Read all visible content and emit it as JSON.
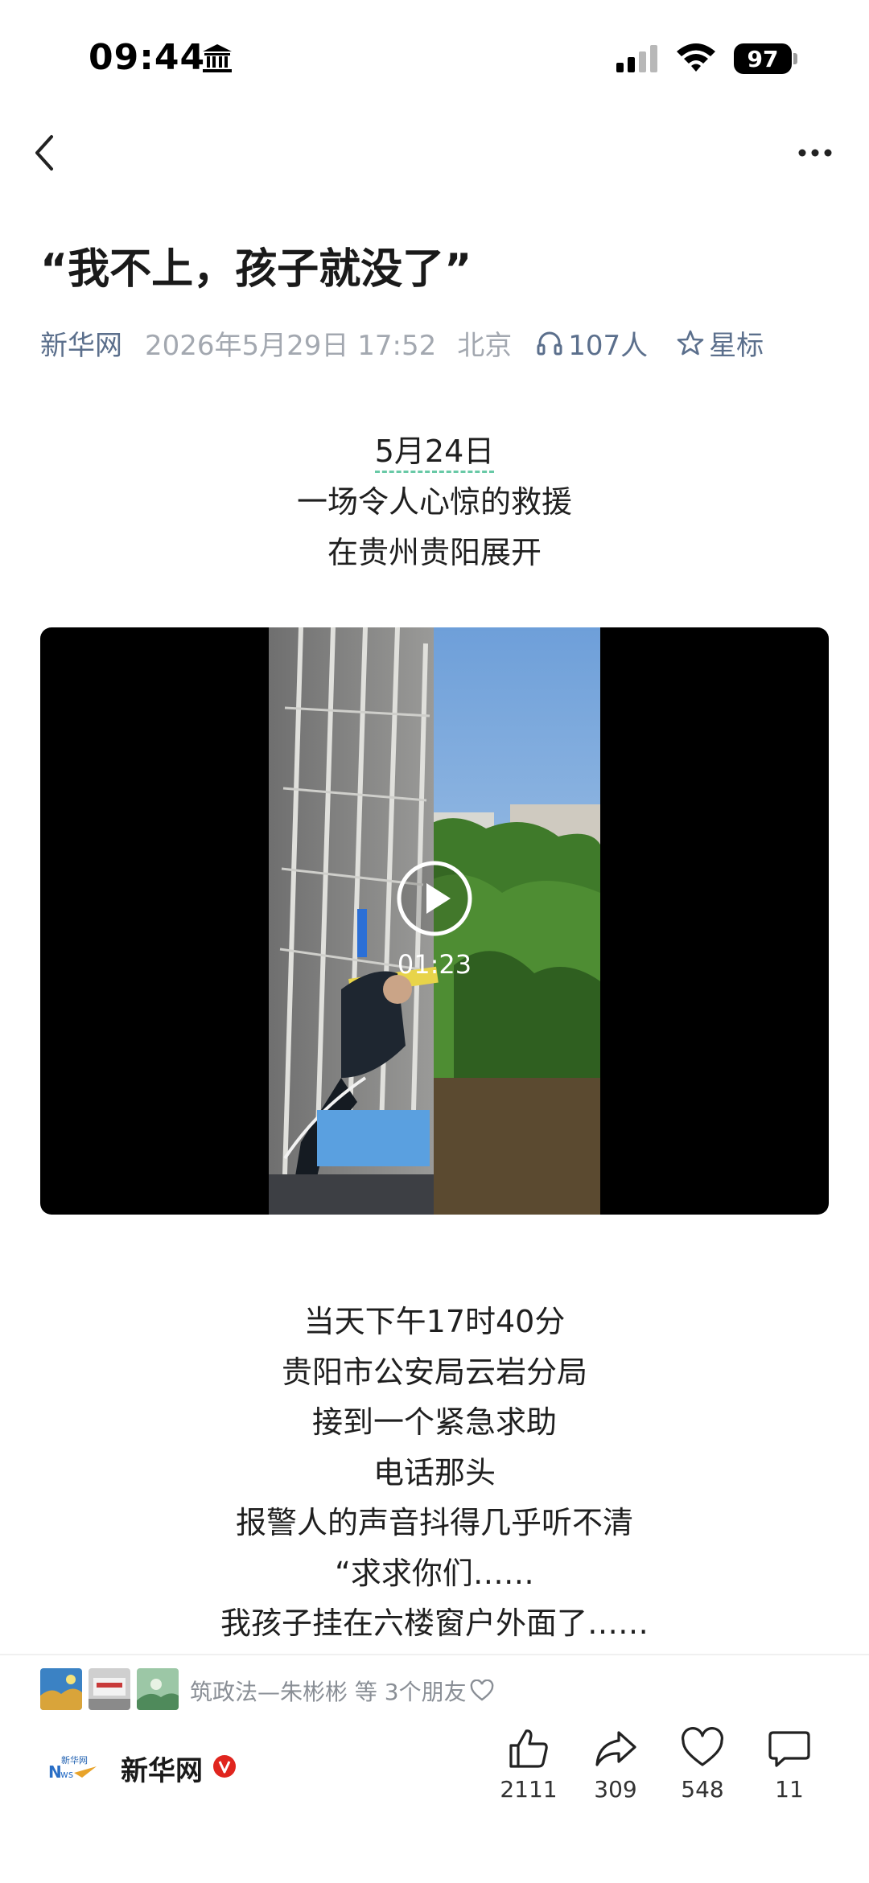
{
  "status_bar": {
    "time": "09:44",
    "battery": "97"
  },
  "article": {
    "title": "“我不上，孩子就没了”",
    "source": "新华网",
    "date": "2026年5月29日 17:52",
    "location": "北京",
    "listeners": "107人",
    "star_label": "星标"
  },
  "intro_lines": [
    "5月24日",
    "一场令人心惊的救援",
    "在贵州贵阳展开"
  ],
  "video": {
    "duration": "01:23"
  },
  "body_lines": [
    "当天下午17时40分",
    "贵阳市公安局云岩分局",
    "接到一个紧急求助",
    "电话那头",
    "报警人的声音抖得几乎听不清",
    "“求求你们……",
    "我孩子挂在六楼窗户外面了……"
  ],
  "friends": {
    "text": "筑政法—朱彬彬 等 3个朋友"
  },
  "publisher": {
    "name": "新华网"
  },
  "actions": {
    "like": "2111",
    "share": "309",
    "favorite": "548",
    "comment": "11"
  }
}
